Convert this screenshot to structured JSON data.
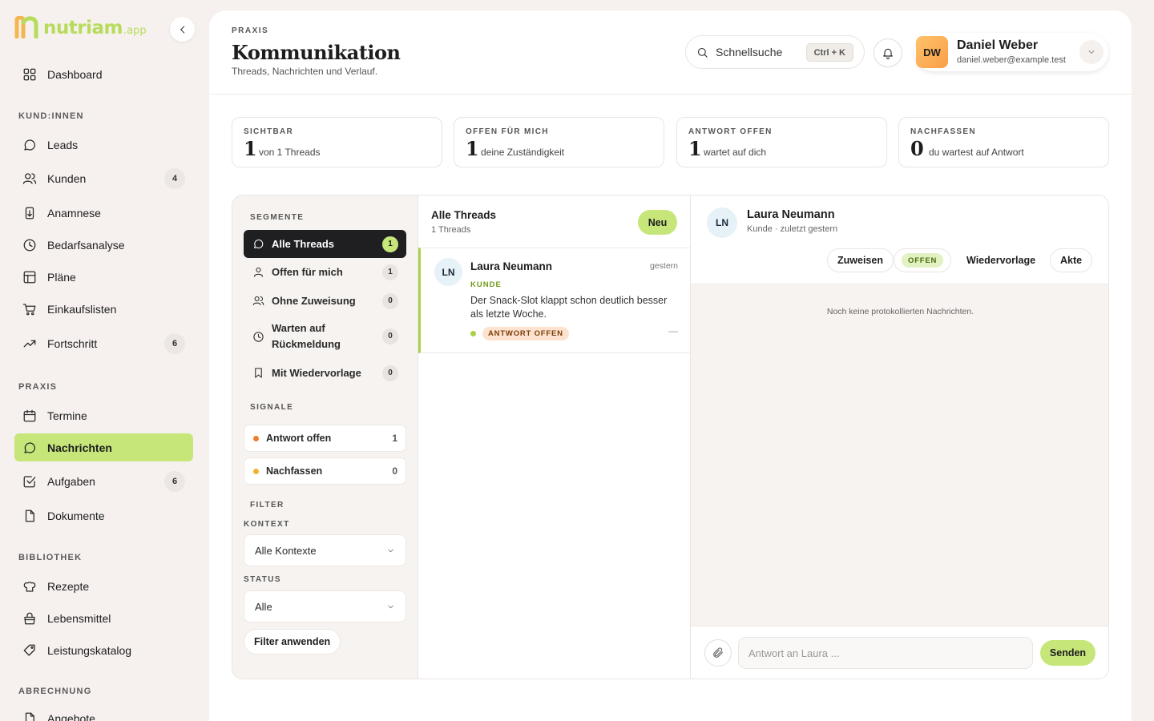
{
  "brand": {
    "name": "nutriam",
    "tld": ".app",
    "accent": "#c6e67a"
  },
  "sidebar": {
    "dashboard": "Dashboard",
    "sections": {
      "clients": "KUND:INNEN",
      "practice": "PRAXIS",
      "library": "BIBLIOTHEK",
      "billing": "ABRECHNUNG"
    },
    "items": {
      "leads": {
        "label": "Leads",
        "icon": "chat-bubble-icon"
      },
      "kunden": {
        "label": "Kunden",
        "icon": "users-icon",
        "badge": "4"
      },
      "anamnese": {
        "label": "Anamnese",
        "icon": "clipboard-icon"
      },
      "bedarfsanalyse": {
        "label": "Bedarfsanalyse",
        "icon": "clock-icon"
      },
      "plaene": {
        "label": "Pläne",
        "icon": "table-icon"
      },
      "einkaufslisten": {
        "label": "Einkaufslisten",
        "icon": "cart-icon"
      },
      "fortschritt": {
        "label": "Fortschritt",
        "icon": "trend-icon",
        "badge": "6"
      },
      "termine": {
        "label": "Termine",
        "icon": "calendar-icon"
      },
      "nachrichten": {
        "label": "Nachrichten",
        "icon": "chat-bubble-icon"
      },
      "aufgaben": {
        "label": "Aufgaben",
        "icon": "checkbox-icon",
        "badge": "6"
      },
      "dokumente": {
        "label": "Dokumente",
        "icon": "document-icon"
      },
      "rezepte": {
        "label": "Rezepte",
        "icon": "chef-hat-icon"
      },
      "lebensmittel": {
        "label": "Lebensmittel",
        "icon": "shopping-bag-icon"
      },
      "leistungskatalog": {
        "label": "Leistungskatalog",
        "icon": "tag-icon"
      },
      "angebote": {
        "label": "Angebote",
        "icon": "document-icon"
      }
    }
  },
  "header": {
    "eyebrow": "PRAXIS",
    "title": "Kommunikation",
    "subtitle": "Threads, Nachrichten und Verlauf.",
    "search_label": "Schnellsuche",
    "search_shortcut": "Ctrl + K",
    "user": {
      "initials": "DW",
      "name": "Daniel Weber",
      "email": "daniel.weber@example.test"
    }
  },
  "stats": [
    {
      "label": "SICHTBAR",
      "value": "1",
      "desc": "von 1 Threads"
    },
    {
      "label": "OFFEN FÜR MICH",
      "value": "1",
      "desc": "deine Zuständigkeit"
    },
    {
      "label": "ANTWORT OFFEN",
      "value": "1",
      "desc": "wartet auf dich"
    },
    {
      "label": "NACHFASSEN",
      "value": "0",
      "desc": "du wartest auf Antwort"
    }
  ],
  "segments": {
    "heading": "SEGMENTE",
    "items": [
      {
        "label": "Alle Threads",
        "count": "1"
      },
      {
        "label": "Offen für mich",
        "count": "1"
      },
      {
        "label": "Ohne Zuweisung",
        "count": "0"
      },
      {
        "label": "Warten auf Rückmeldung",
        "count": "0"
      },
      {
        "label": "Mit Wiedervorlage",
        "count": "0"
      }
    ]
  },
  "signals": {
    "heading": "SIGNALE",
    "items": [
      {
        "label": "Antwort offen",
        "count": "1",
        "color": "#f07c2c"
      },
      {
        "label": "Nachfassen",
        "count": "0",
        "color": "#f2b230"
      }
    ]
  },
  "filter": {
    "heading": "FILTER",
    "context_label": "KONTEXT",
    "context_value": "Alle Kontexte",
    "status_label": "STATUS",
    "status_value": "Alle",
    "apply": "Filter anwenden"
  },
  "threads": {
    "title": "Alle Threads",
    "count": "1 Threads",
    "new_button": "Neu",
    "items": [
      {
        "initials": "LN",
        "name": "Laura Neumann",
        "time": "gestern",
        "role": "KUNDE",
        "message": "Der Snack-Slot klappt schon deutlich besser als letzte Woche.",
        "status": "ANTWORT OFFEN",
        "trailing": "—"
      }
    ]
  },
  "conversation": {
    "initials": "LN",
    "name": "Laura Neumann",
    "meta": "Kunde · zuletzt gestern",
    "actions": {
      "assign": "Zuweisen",
      "status": "OFFEN",
      "followup": "Wiedervorlage",
      "file": "Akte"
    },
    "empty": "Noch keine protokollierten Nachrichten.",
    "reply_placeholder": "Antwort an Laura ...",
    "send": "Senden"
  }
}
